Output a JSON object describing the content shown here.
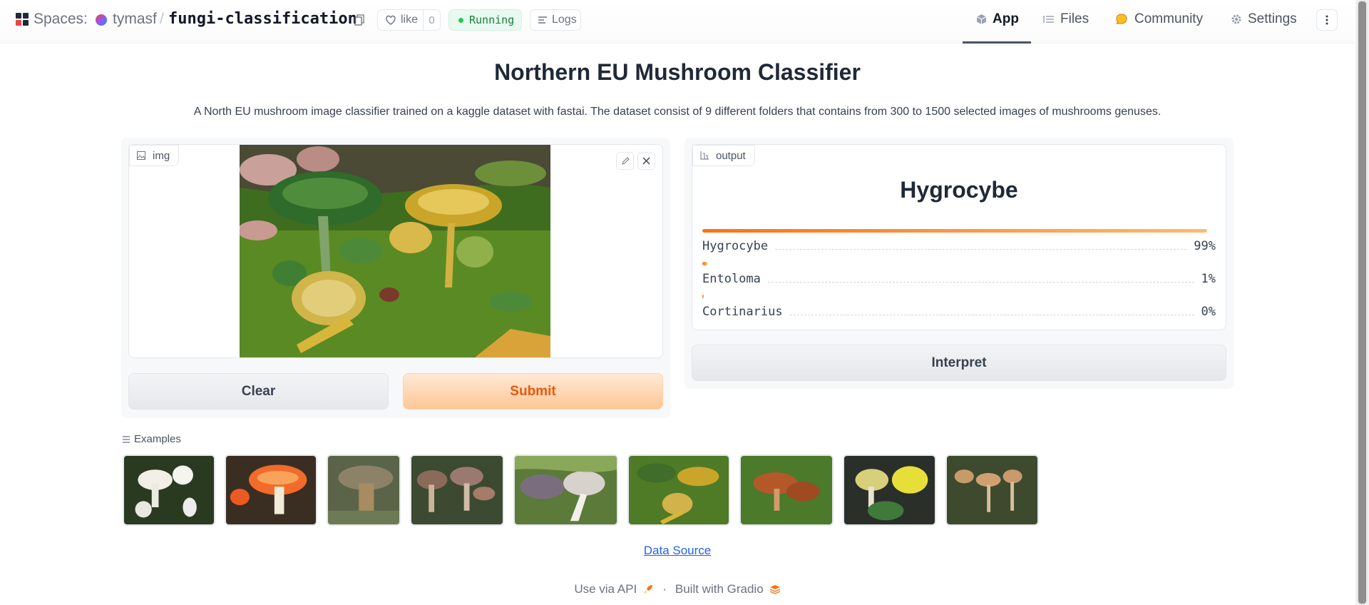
{
  "header": {
    "spaces_label": "Spaces:",
    "owner": "tymasf",
    "separator": "/",
    "repo": "fungi-classification",
    "like_label": "like",
    "like_count": "0",
    "status": "Running",
    "logs_label": "Logs"
  },
  "nav": {
    "app": "App",
    "files": "Files",
    "community": "Community",
    "settings": "Settings",
    "active": "App"
  },
  "main": {
    "title": "Northern EU Mushroom Classifier",
    "description": "A North EU mushroom image classifier trained on a kaggle dataset with fastai. The dataset consist of 9 different folders that contains from 300 to 1500 selected images of mushrooms genuses."
  },
  "input": {
    "label": "img",
    "clear_label": "Clear",
    "submit_label": "Submit"
  },
  "output": {
    "label": "output",
    "top_label": "Hygrocybe",
    "confidences": [
      {
        "name": "Hygrocybe",
        "pct": "99%",
        "value": 0.99
      },
      {
        "name": "Entoloma",
        "pct": "1%",
        "value": 0.01
      },
      {
        "name": "Cortinarius",
        "pct": "0%",
        "value": 0.0
      }
    ],
    "interpret_label": "Interpret"
  },
  "examples": {
    "label": "Examples",
    "items": [
      "example-1",
      "example-2",
      "example-3",
      "example-4",
      "example-5",
      "example-6",
      "example-7",
      "example-8",
      "example-9"
    ]
  },
  "links": {
    "data_source": "Data Source"
  },
  "footer": {
    "api": "Use via API",
    "dot": "·",
    "built": "Built with Gradio"
  },
  "colors": {
    "accent": "#f97316",
    "running": "#22c55e",
    "link": "#2563eb"
  }
}
